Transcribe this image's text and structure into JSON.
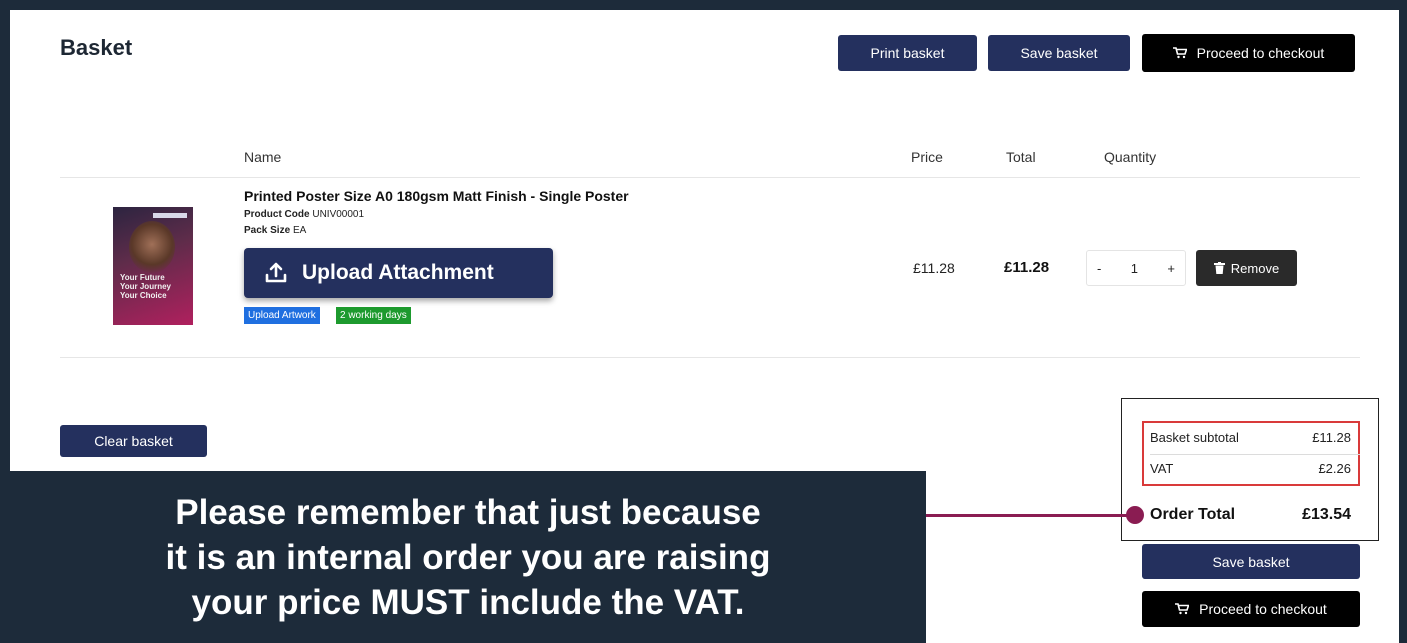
{
  "page": {
    "title": "Basket"
  },
  "toolbar": {
    "print_label": "Print basket",
    "save_label": "Save basket",
    "checkout_label": "Proceed to checkout"
  },
  "table": {
    "headers": {
      "name": "Name",
      "price": "Price",
      "total": "Total",
      "quantity": "Quantity"
    }
  },
  "item": {
    "name": "Printed Poster Size A0 180gsm Matt Finish - Single Poster",
    "code_label": "Product Code",
    "code": "UNIV00001",
    "pack_label": "Pack Size",
    "pack": "EA",
    "thumb_lines": [
      "Your Future",
      "Your Journey",
      "Your Choice"
    ],
    "upload_label": "Upload Attachment",
    "badges": [
      "Upload Artwork",
      "2 working days"
    ],
    "price": "£11.28",
    "total": "£11.28",
    "qty_minus": "-",
    "qty_value": "1",
    "qty_plus": "+",
    "remove_label": "Remove"
  },
  "clear_label": "Clear basket",
  "summary": {
    "subtotal_label": "Basket subtotal",
    "subtotal": "£11.28",
    "vat_label": "VAT",
    "vat": "£2.26",
    "total_label": "Order Total",
    "total": "£13.54",
    "save_label": "Save basket",
    "checkout_label": "Proceed to checkout"
  },
  "callout": {
    "lines": [
      "Please remember that just because",
      "it is an internal order you are raising",
      "your price MUST include the VAT."
    ]
  },
  "colors": {
    "navy": "#24305e",
    "callout_bg": "#1d2b3a",
    "connector": "#8a1c52",
    "highlight": "#d93a3a",
    "badge_blue": "#1f6fe0",
    "badge_green": "#1d9a2e"
  },
  "icons": {
    "cart": "cart-icon",
    "upload": "upload-icon",
    "trash": "trash-icon"
  }
}
